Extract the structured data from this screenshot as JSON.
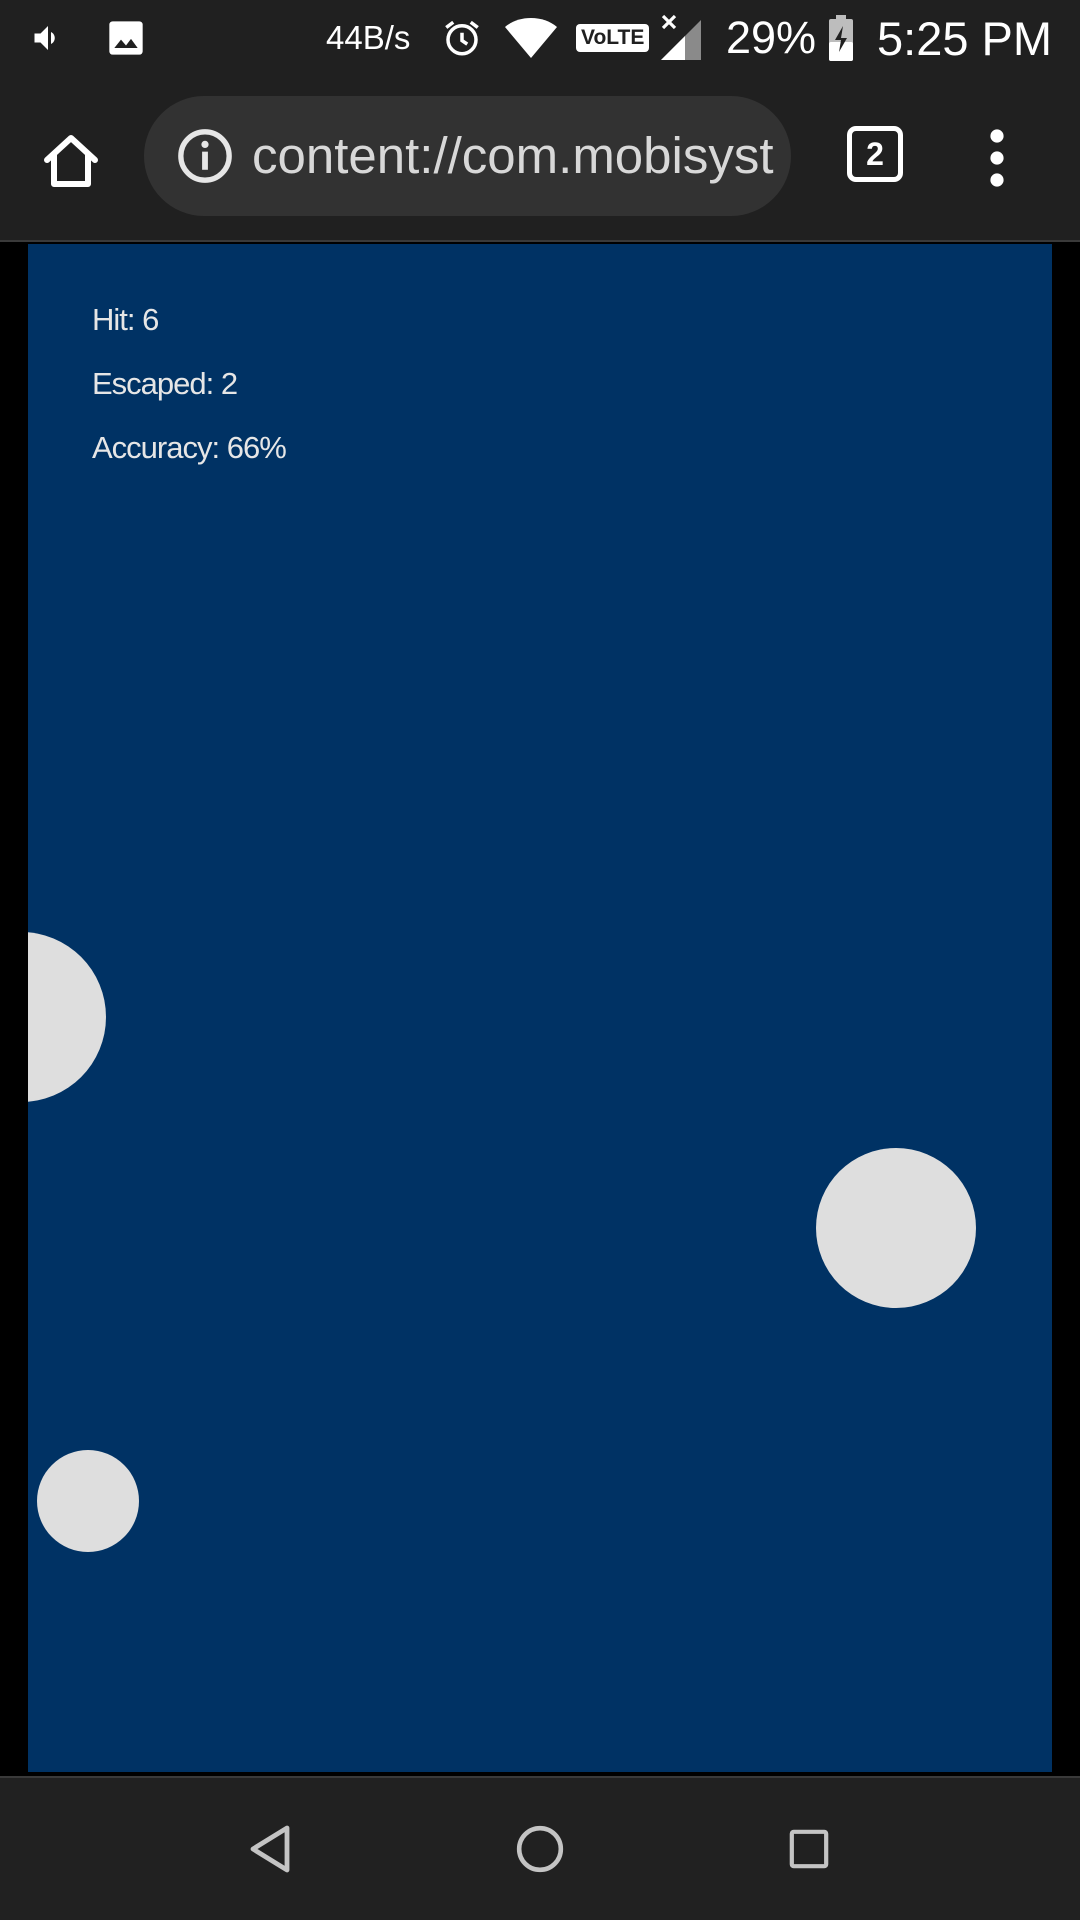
{
  "status_bar": {
    "network_speed": "44B/s",
    "battery_percent": "29%",
    "time": "5:25 PM",
    "volte_label": "VoLTE",
    "icons": [
      "volume-icon",
      "gallery-icon",
      "alarm-icon",
      "wifi-icon",
      "volte-icon",
      "signal-icon",
      "battery-charging-icon"
    ]
  },
  "toolbar": {
    "url": "content://com.mobisystems.office",
    "tab_count": "2",
    "icons": [
      "home-icon",
      "info-icon",
      "tabs-icon",
      "overflow-menu-icon"
    ]
  },
  "game": {
    "background_color": "#003264",
    "target_color": "#dedede",
    "stats": {
      "hit": "Hit: 6",
      "escaped": "Escaped: 2",
      "accuracy": "Accuracy: 66%"
    }
  },
  "nav_bar": {
    "icons": [
      "back-icon",
      "home-circle-icon",
      "recents-icon"
    ]
  }
}
